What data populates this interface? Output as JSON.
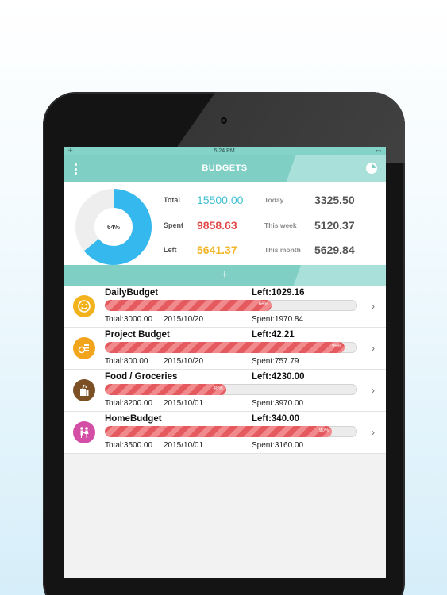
{
  "status": {
    "time": "5:24 PM"
  },
  "nav": {
    "title": "BUDGETS",
    "menu_icon": "more-vertical-icon",
    "chart_icon": "pie-chart-icon"
  },
  "summary": {
    "progress_percent": 64,
    "progress_label": "64%",
    "total_label": "Total",
    "total_value": "15500.00",
    "spent_label": "Spent",
    "spent_value": "9858.63",
    "left_label": "Left",
    "left_value": "5641.37",
    "today_label": "Today",
    "today_value": "3325.50",
    "week_label": "This week",
    "week_value": "5120.37",
    "month_label": "This month",
    "month_value": "5629.84",
    "colors": {
      "donut": "#35b8ee",
      "donut_track": "#eeeeee"
    }
  },
  "add_button": {
    "label": "+"
  },
  "budgets": [
    {
      "name": "DailyBudget",
      "left": "Left:1029.16",
      "progress": 66,
      "progress_label": "66%",
      "total": "Total:3000.00",
      "date": "2015/10/20",
      "spent": "Spent:1970.84",
      "icon": "smiley-icon",
      "icon_color": "#f2b21c",
      "chevron": "›"
    },
    {
      "name": "Project Budget",
      "left": "Left:42.21",
      "progress": 95,
      "progress_label": "95%",
      "total": "Total:800.00",
      "date": "2015/10/20",
      "spent": "Spent:757.79",
      "icon": "money-icon",
      "icon_color": "#f2a51c",
      "chevron": "›"
    },
    {
      "name": "Food / Groceries",
      "left": "Left:4230.00",
      "progress": 48,
      "progress_label": "48%",
      "total": "Total:8200.00",
      "date": "2015/10/01",
      "spent": "Spent:3970.00",
      "icon": "groceries-icon",
      "icon_color": "#7a5024",
      "chevron": "›"
    },
    {
      "name": "HomeBudget",
      "left": "Left:340.00",
      "progress": 90,
      "progress_label": "90%",
      "total": "Total:3500.00",
      "date": "2015/10/01",
      "spent": "Spent:3160.00",
      "icon": "family-icon",
      "icon_color": "#d24fa5",
      "chevron": "›"
    }
  ]
}
